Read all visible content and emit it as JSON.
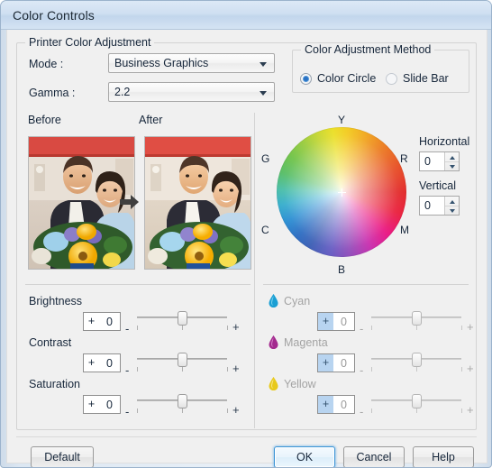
{
  "window": {
    "title": "Color Controls"
  },
  "printer_color_adjustment": {
    "legend": "Printer Color Adjustment",
    "mode_label": "Mode :",
    "mode_value": "Business Graphics",
    "gamma_label": "Gamma :",
    "gamma_value": "2.2"
  },
  "color_adjustment_method": {
    "legend": "Color Adjustment Method",
    "options": [
      {
        "label": "Color Circle",
        "selected": true
      },
      {
        "label": "Slide Bar",
        "selected": false
      }
    ]
  },
  "preview": {
    "before_label": "Before",
    "after_label": "After",
    "arrow_icon": "right-arrow-icon"
  },
  "color_circle": {
    "axis_labels": {
      "top": "Y",
      "top_right": "R",
      "bottom_right": "M",
      "bottom": "B",
      "bottom_left": "C",
      "top_left": "G"
    },
    "horizontal_label": "Horizontal",
    "horizontal_value": "0",
    "vertical_label": "Vertical",
    "vertical_value": "0"
  },
  "image_sliders": [
    {
      "label": "Brightness",
      "sign": "+",
      "value": "0",
      "minus": "-",
      "plus": "+",
      "position": 50,
      "enabled": true
    },
    {
      "label": "Contrast",
      "sign": "+",
      "value": "0",
      "minus": "-",
      "plus": "+",
      "position": 50,
      "enabled": true
    },
    {
      "label": "Saturation",
      "sign": "+",
      "value": "0",
      "minus": "-",
      "plus": "+",
      "position": 50,
      "enabled": true
    }
  ],
  "ink_sliders": [
    {
      "label": "Cyan",
      "icon": "cyan-ink-drop-icon",
      "color": "#1a9fd4",
      "sign": "+",
      "value": "0",
      "minus": "-",
      "plus": "+",
      "position": 50,
      "enabled": false
    },
    {
      "label": "Magenta",
      "icon": "magenta-ink-drop-icon",
      "color": "#a3298e",
      "sign": "+",
      "value": "0",
      "minus": "-",
      "plus": "+",
      "position": 50,
      "enabled": false
    },
    {
      "label": "Yellow",
      "icon": "yellow-ink-drop-icon",
      "color": "#e8c91a",
      "sign": "+",
      "value": "0",
      "minus": "-",
      "plus": "+",
      "position": 50,
      "enabled": false
    }
  ],
  "footer": {
    "default_label": "Default",
    "ok_label": "OK",
    "cancel_label": "Cancel",
    "help_label": "Help"
  },
  "colors": {
    "titlebar_accent": "#c2d6ec",
    "dialog_bg": "#f0f0f0",
    "focus_blue": "#3c94d6",
    "disabled_text": "#a3a3a3"
  }
}
